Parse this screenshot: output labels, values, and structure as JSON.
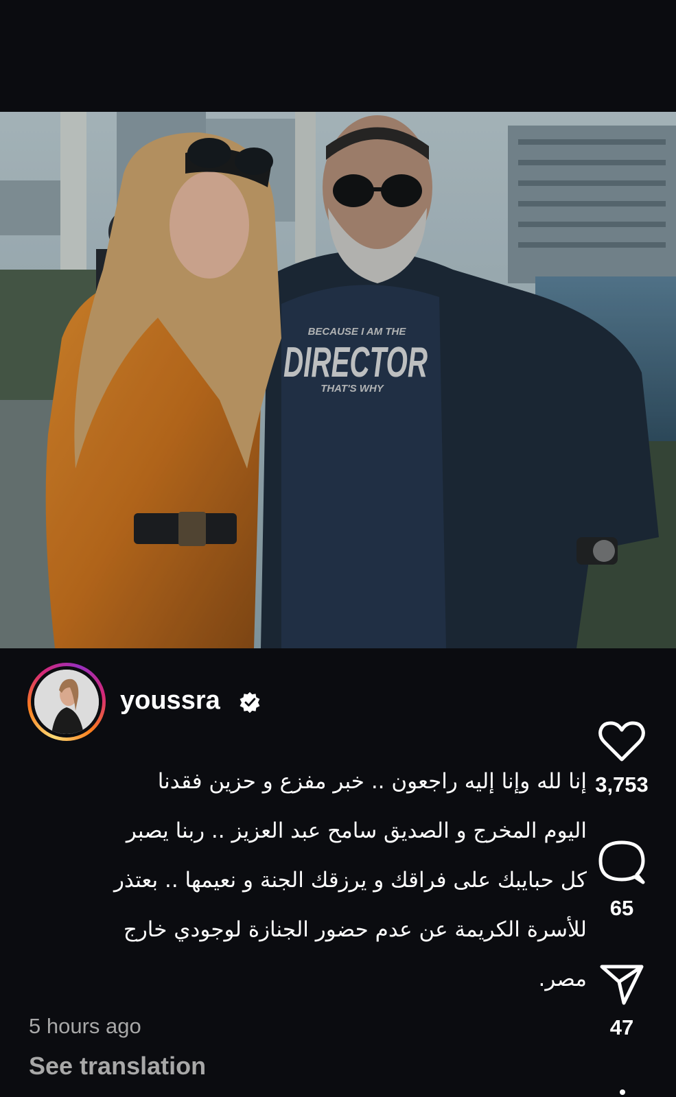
{
  "post": {
    "username": "youssra",
    "verified": true,
    "caption_lines": [
      "إنا لله وإنا إليه راجعون .. خبر مفزع و حزين فقدنا",
      "اليوم المخرج و الصديق سامح عبد العزيز .. ربنا يصبر",
      "كل حبايبك على فراقك و يرزقك الجنة و نعيمها .. بعتذر",
      "للأسرة الكريمة عن عدم حضور الجنازة لوجودي خارج",
      "مصر."
    ],
    "timestamp": "5 hours ago",
    "see_translation": "See translation"
  },
  "photo": {
    "shirt_line1": "BECAUSE I AM THE",
    "shirt_line2": "DIRECTOR",
    "shirt_line3": "THAT'S WHY"
  },
  "actions": {
    "likes": "3,753",
    "comments": "65",
    "shares": "47",
    "like_icon": "heart-icon",
    "comment_icon": "comment-icon",
    "share_icon": "send-icon"
  },
  "colors": {
    "background": "#0b0c10",
    "text": "#ffffff",
    "muted": "#a8a8a8"
  }
}
